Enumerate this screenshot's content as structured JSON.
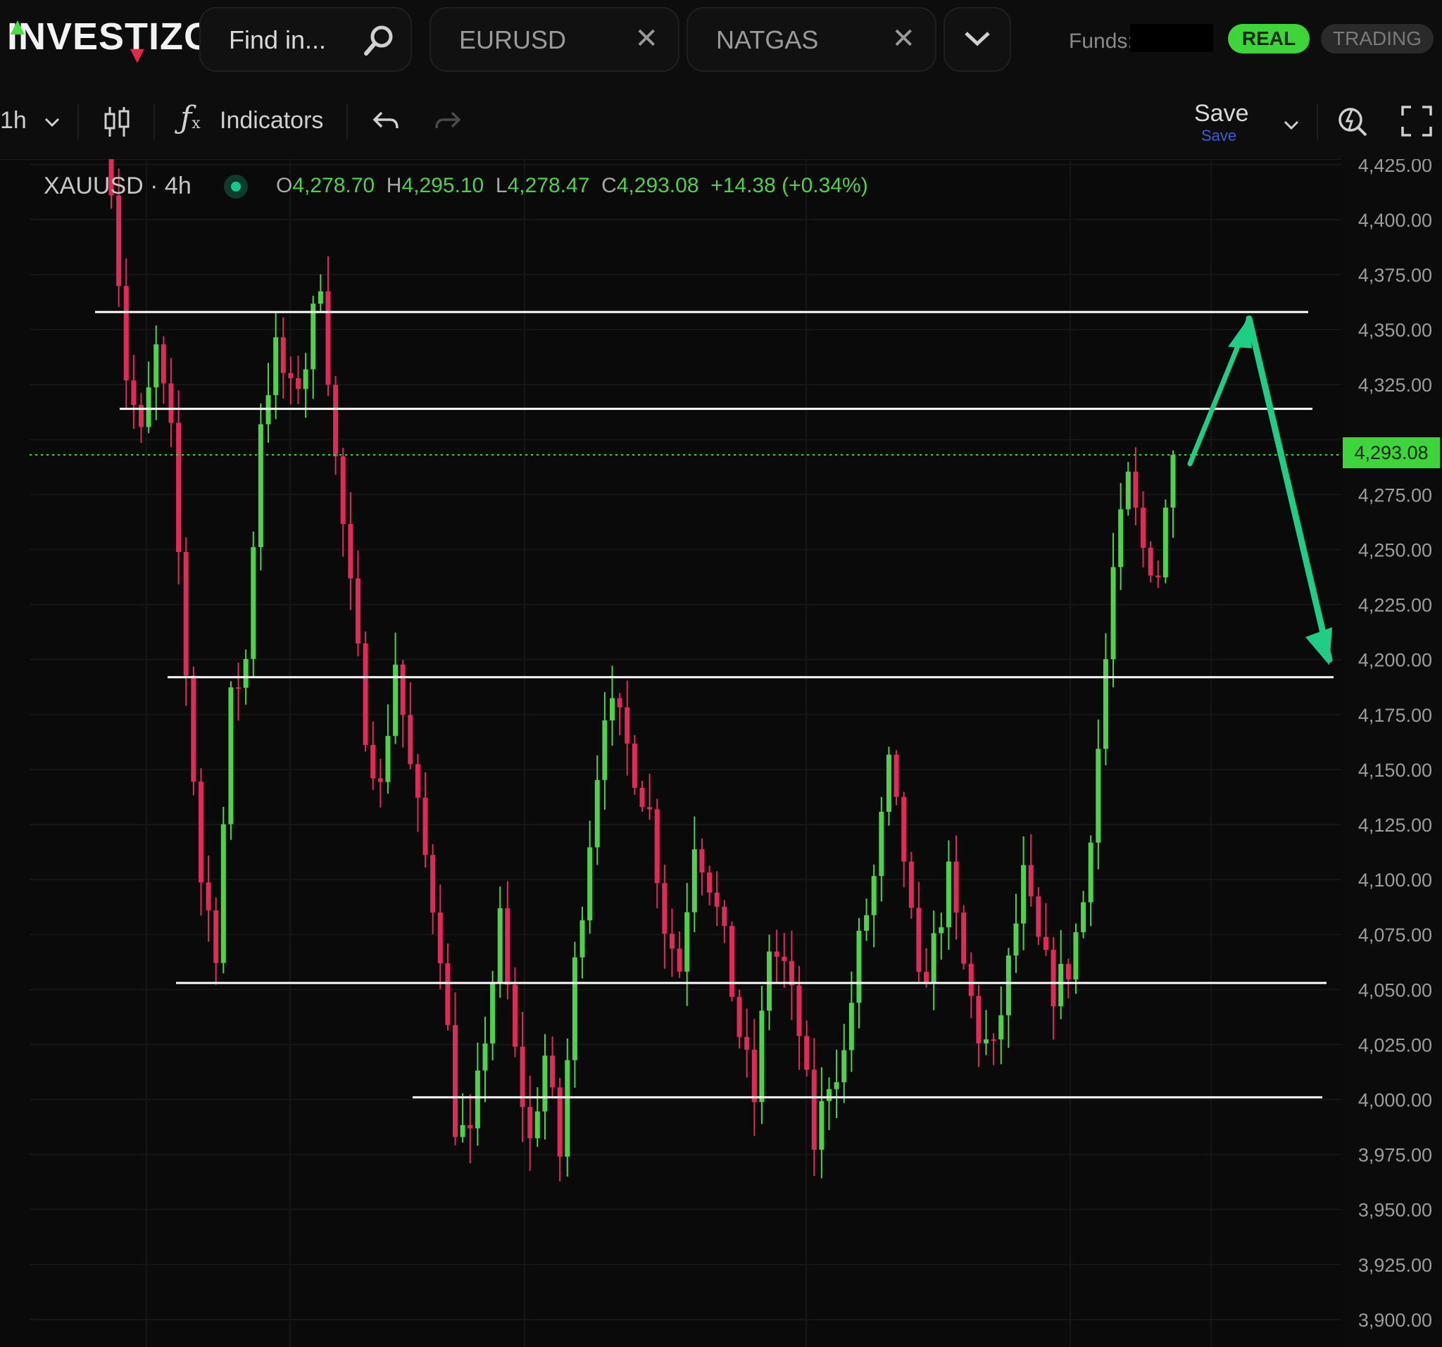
{
  "app": {
    "logo_text": "INVESTIZO"
  },
  "topbar": {
    "search_placeholder": "Find in...",
    "tabs": [
      {
        "label": "EURUSD"
      },
      {
        "label": "NATGAS"
      }
    ],
    "funds_label": "Funds:",
    "real_label": "REAL",
    "trading_label": "TRADING"
  },
  "toolbar": {
    "timeframe": "1h",
    "indicators_label": "Indicators",
    "save_label": "Save",
    "save_sub": "Save"
  },
  "legend": {
    "symbol": "XAUUSD · 4h",
    "open_key": "O",
    "open": "4,278.70",
    "high_key": "H",
    "high": "4,295.10",
    "low_key": "L",
    "low": "4,278.47",
    "close_key": "C",
    "close": "4,293.08",
    "change": "+14.38 (+0.34%)"
  },
  "colors": {
    "up": "#4fd14c",
    "down": "#e02a5a",
    "accent": "#3ed53a",
    "arrow": "#1fce84"
  },
  "chart_data": {
    "type": "candlestick",
    "symbol": "XAUUSD",
    "interval": "4h",
    "ylim": [
      3887.5,
      4427.5
    ],
    "y_ticks": [
      "4,425.00",
      "4,400.00",
      "4,375.00",
      "4,350.00",
      "4,325.00",
      "4,300.00",
      "4,275.00",
      "4,250.00",
      "4,225.00",
      "4,200.00",
      "4,175.00",
      "4,150.00",
      "4,125.00",
      "4,100.00",
      "4,075.00",
      "4,050.00",
      "4,025.00",
      "4,000.00",
      "3,975.00",
      "3,950.00",
      "3,925.00",
      "3,900.00"
    ],
    "last_price": 4293.08,
    "last_price_label": "4,293.08",
    "horizontal_levels": [
      4358,
      4314,
      4192,
      4053,
      4001
    ],
    "projection_path": [
      4289,
      4355,
      4200
    ],
    "anchors": [
      [
        0,
        4420
      ],
      [
        2,
        4330
      ],
      [
        4,
        4300
      ],
      [
        6,
        4340
      ],
      [
        8,
        4300
      ],
      [
        10,
        4195
      ],
      [
        12,
        4100
      ],
      [
        14,
        4070
      ],
      [
        16,
        4180
      ],
      [
        18,
        4200
      ],
      [
        20,
        4310
      ],
      [
        22,
        4340
      ],
      [
        24,
        4320
      ],
      [
        26,
        4335
      ],
      [
        28,
        4375
      ],
      [
        30,
        4290
      ],
      [
        32,
        4230
      ],
      [
        34,
        4170
      ],
      [
        36,
        4140
      ],
      [
        38,
        4200
      ],
      [
        40,
        4150
      ],
      [
        42,
        4110
      ],
      [
        44,
        4070
      ],
      [
        46,
        3990
      ],
      [
        48,
        3980
      ],
      [
        50,
        4030
      ],
      [
        52,
        4080
      ],
      [
        54,
        4020
      ],
      [
        56,
        3980
      ],
      [
        58,
        4020
      ],
      [
        60,
        3975
      ],
      [
        62,
        4060
      ],
      [
        64,
        4120
      ],
      [
        66,
        4180
      ],
      [
        68,
        4170
      ],
      [
        70,
        4150
      ],
      [
        72,
        4130
      ],
      [
        74,
        4080
      ],
      [
        76,
        4060
      ],
      [
        78,
        4120
      ],
      [
        80,
        4100
      ],
      [
        82,
        4070
      ],
      [
        84,
        4030
      ],
      [
        86,
        4000
      ],
      [
        88,
        4070
      ],
      [
        90,
        4060
      ],
      [
        92,
        4030
      ],
      [
        94,
        3980
      ],
      [
        96,
        4010
      ],
      [
        98,
        4020
      ],
      [
        100,
        4070
      ],
      [
        102,
        4100
      ],
      [
        104,
        4150
      ],
      [
        106,
        4110
      ],
      [
        108,
        4050
      ],
      [
        110,
        4070
      ],
      [
        112,
        4100
      ],
      [
        114,
        4060
      ],
      [
        116,
        4030
      ],
      [
        118,
        4020
      ],
      [
        120,
        4060
      ],
      [
        122,
        4100
      ],
      [
        124,
        4070
      ],
      [
        126,
        4050
      ],
      [
        128,
        4060
      ],
      [
        130,
        4090
      ],
      [
        132,
        4160
      ],
      [
        134,
        4240
      ],
      [
        136,
        4280
      ],
      [
        138,
        4250
      ],
      [
        140,
        4240
      ],
      [
        142,
        4293.08
      ]
    ]
  }
}
